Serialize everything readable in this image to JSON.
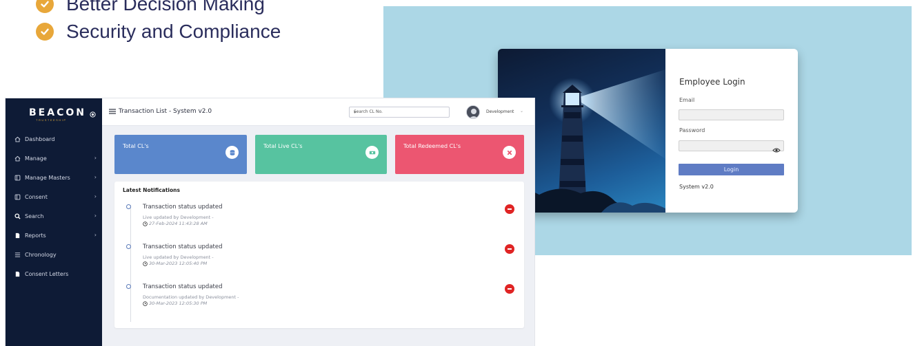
{
  "headline": {
    "bullets": [
      "Better Decision Making",
      "Security and Compliance"
    ]
  },
  "login": {
    "title": "Employee Login",
    "email_label": "Email",
    "password_label": "Password",
    "login_button": "Login",
    "system_version": "System v2.0",
    "background_color": "#acd7e6",
    "button_color": "#5f7cc4"
  },
  "dashboard": {
    "brand": {
      "name": "BEACON",
      "sub": "TRUSTEESHIP"
    },
    "sidebar": {
      "items": [
        {
          "label": "Dashboard",
          "icon": "home-icon",
          "has_submenu": false
        },
        {
          "label": "Manage",
          "icon": "home-icon",
          "has_submenu": true
        },
        {
          "label": "Manage Masters",
          "icon": "panel-icon",
          "has_submenu": true
        },
        {
          "label": "Consent",
          "icon": "panel-icon",
          "has_submenu": true
        },
        {
          "label": "Search",
          "icon": "search-icon",
          "has_submenu": true
        },
        {
          "label": "Reports",
          "icon": "file-icon",
          "has_submenu": true
        },
        {
          "label": "Chronology",
          "icon": "list-icon",
          "has_submenu": false
        },
        {
          "label": "Consent Letters",
          "icon": "file-icon",
          "has_submenu": false
        }
      ],
      "background_color": "#0e1b36"
    },
    "topbar": {
      "title": "Transaction List - System v2.0",
      "search_placeholder": "Search CL No.",
      "user_name": "Development"
    },
    "cards": [
      {
        "label": "Total CL's",
        "color": "#5a87cc",
        "icon": "database-icon"
      },
      {
        "label": "Total Live CL's",
        "color": "#57c3a0",
        "icon": "money-icon"
      },
      {
        "label": "Total Redeemed CL's",
        "color": "#ec5671",
        "icon": "close-icon"
      }
    ],
    "notifications": {
      "title": "Latest Notifications",
      "items": [
        {
          "heading": "Transaction status updated",
          "detail": "Live updated by Development -",
          "time": "27-Feb-2024 11:43:28 AM"
        },
        {
          "heading": "Transaction status updated",
          "detail": "Live updated by Development -",
          "time": "30-Mar-2023 12:05:40 PM"
        },
        {
          "heading": "Transaction status updated",
          "detail": "Documentation updated by Development -",
          "time": "30-Mar-2023 12:05:30 PM"
        }
      ]
    }
  }
}
